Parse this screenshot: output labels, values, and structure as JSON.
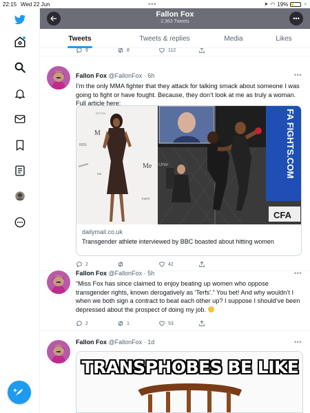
{
  "status_bar": {
    "time": "22:15",
    "date": "Wed 22 Jun",
    "battery": "19%"
  },
  "header": {
    "title": "Fallon Fox",
    "subtitle": "2,363 Tweets"
  },
  "tabs": [
    {
      "label": "Tweets",
      "active": true
    },
    {
      "label": "Tweets & replies",
      "active": false
    },
    {
      "label": "Media",
      "active": false
    },
    {
      "label": "Likes",
      "active": false
    }
  ],
  "sidebar": {
    "icons": [
      "twitter-bird-icon",
      "home-icon",
      "search-icon",
      "notifications-icon",
      "messages-icon",
      "bookmarks-icon",
      "lists-icon",
      "profile-avatar",
      "more-icon"
    ],
    "compose_label": "+"
  },
  "top_actions": {
    "replies": "9",
    "retweets": "8",
    "likes": "112"
  },
  "tweets": [
    {
      "name": "Fallon Fox",
      "handle": "@FallonFox",
      "time": "6h",
      "text": "I’m the only MMA fighter that they attack for talking smack about someone I was going to fight or have fought. Because, they don’t look at me as truly a woman. Full article here:",
      "card": {
        "domain": "dailymail.co.uk",
        "title": "Transgender athlete interviewed by BBC boasted about hitting women",
        "banner_text": "FA FIGHTS.COM",
        "logo_text": "CFA"
      },
      "replies": "2",
      "retweets": "",
      "likes": "42"
    },
    {
      "name": "Fallon Fox",
      "handle": "@FallonFox",
      "time": "5h",
      "text": "“Miss Fox has since claimed to enjoy beating up women who oppose transgender rights, known derogatively as 'Terfs'.” You bet! And why wouldn’t I when we both sign a contract to beat each other up? I suppose I should’ve been depressed about the prospect of doing my job.",
      "replies": "2",
      "retweets": "1",
      "likes": "53"
    },
    {
      "name": "Fallon Fox",
      "handle": "@FallonFox",
      "time": "1d",
      "meme_text": "TRANSPHOBES BE LIKE"
    }
  ],
  "colors": {
    "accent": "#1d9bf0",
    "header_bg": "#6d6d78",
    "text_secondary": "#536471"
  }
}
